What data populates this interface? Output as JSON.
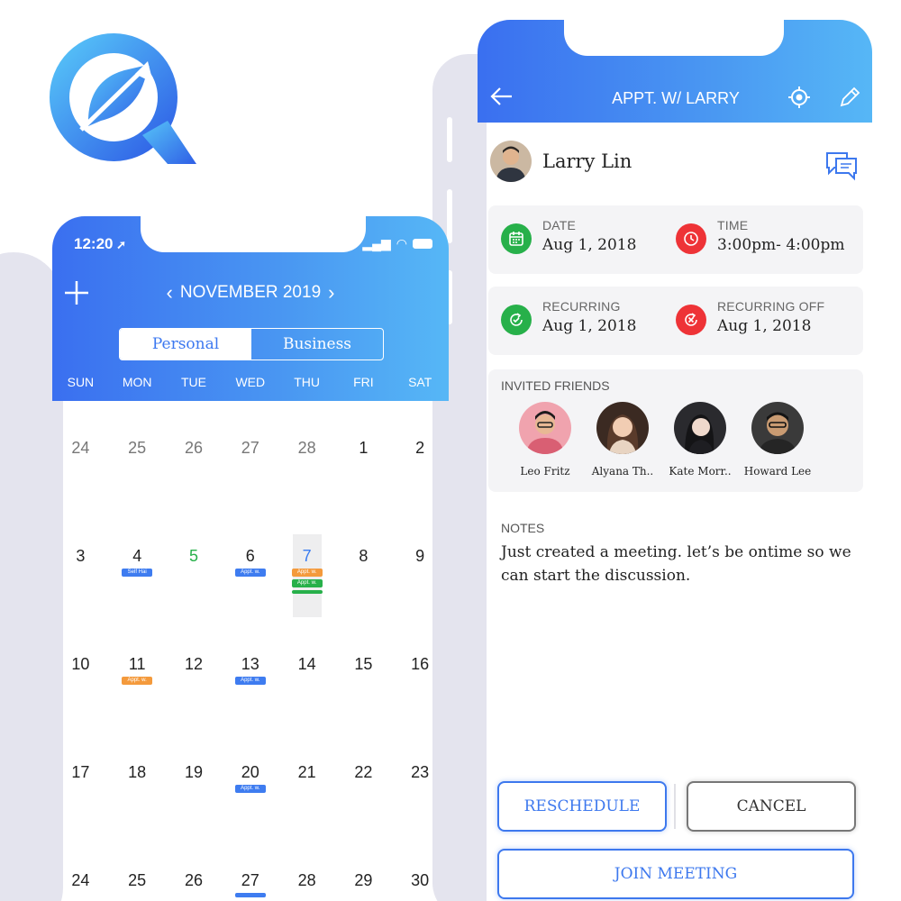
{
  "calendar": {
    "status_time": "12:20",
    "month_label": "NOVEMBER 2019",
    "segments": {
      "personal": "Personal",
      "business": "Business"
    },
    "weekdays": [
      "SUN",
      "MON",
      "TUE",
      "WED",
      "THU",
      "FRI",
      "SAT"
    ],
    "weeks": [
      [
        "24",
        "25",
        "26",
        "27",
        "28",
        "1",
        "2"
      ],
      [
        "3",
        "4",
        "5",
        "6",
        "7",
        "8",
        "9"
      ],
      [
        "10",
        "11",
        "12",
        "13",
        "14",
        "15",
        "16"
      ],
      [
        "17",
        "18",
        "19",
        "20",
        "21",
        "22",
        "23"
      ],
      [
        "24",
        "25",
        "26",
        "27",
        "28",
        "29",
        "30"
      ]
    ],
    "events": {
      "self_hai": "Self Hai",
      "appt_w": "Appt. w."
    }
  },
  "appointment": {
    "title": "APPT. W/ LARRY",
    "person_name": "Larry Lin",
    "date": {
      "label": "DATE",
      "value": "Aug 1, 2018"
    },
    "time": {
      "label": "TIME",
      "value": "3:00pm- 4:00pm"
    },
    "recurring": {
      "label": "RECURRING",
      "value": "Aug 1, 2018"
    },
    "recurring_off": {
      "label": "RECURRING OFF",
      "value": "Aug 1, 2018"
    },
    "invited_label": "INVITED FRIENDS",
    "friends": [
      {
        "name": "Leo Fritz"
      },
      {
        "name": "Alyana Th.."
      },
      {
        "name": "Kate Morr.."
      },
      {
        "name": "Howard Lee"
      }
    ],
    "notes_label": "NOTES",
    "notes_text": "Just created a meeting. let’s be ontime so we can start the discussion.",
    "buttons": {
      "reschedule": "RESCHEDULE",
      "cancel": "CANCEL",
      "join": "JOIN MEETING"
    }
  },
  "colors": {
    "accent_blue": "#3d78ee",
    "green": "#27b04a",
    "red": "#ee3337",
    "orange": "#f49a3c"
  },
  "icons": [
    "app-logo-icon",
    "add-icon",
    "chevron-left-icon",
    "chevron-right-icon",
    "back-arrow-icon",
    "location-target-icon",
    "pencil-icon",
    "chat-icon",
    "calendar-icon",
    "clock-icon",
    "recurring-icon",
    "recurring-off-icon"
  ]
}
